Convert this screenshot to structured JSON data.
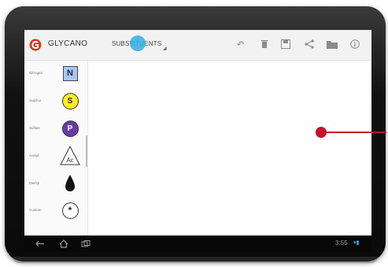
{
  "app": {
    "title": "GLYCANO",
    "logo_color": "#d63a25"
  },
  "toolbar": {
    "tab_label": "SUBSTITUENTS",
    "actions": [
      {
        "name": "undo-icon",
        "glyph": "↶"
      },
      {
        "name": "delete-icon",
        "glyph": "🗑"
      },
      {
        "name": "save-icon",
        "glyph": "💾"
      },
      {
        "name": "share-icon",
        "glyph": "<"
      },
      {
        "name": "folder-icon",
        "glyph": "▬"
      },
      {
        "name": "info-icon",
        "glyph": "ⓘ"
      }
    ]
  },
  "sidebar": {
    "items": [
      {
        "label": "Nitrogen",
        "symbol": "N",
        "shape": "square",
        "color": "#a8c8ee"
      },
      {
        "label": "Sulphur",
        "symbol": "S",
        "shape": "circle",
        "color": "#ffef1a"
      },
      {
        "label": "Sulfate",
        "symbol": "P",
        "shape": "circle",
        "color": "#6a3aa8"
      },
      {
        "label": "Acetyl",
        "symbol": "Ac",
        "shape": "triangle",
        "color": "#ffffff"
      },
      {
        "label": "Methyl",
        "symbol": "",
        "shape": "drop",
        "color": "#111111"
      },
      {
        "label": "Custom",
        "symbol": "*",
        "shape": "circle",
        "color": "#ffffff"
      }
    ]
  },
  "system": {
    "clock": "3:55",
    "status": "▾▮"
  },
  "colors": {
    "touch": "#33aee0",
    "pointer": "#c8102e"
  }
}
